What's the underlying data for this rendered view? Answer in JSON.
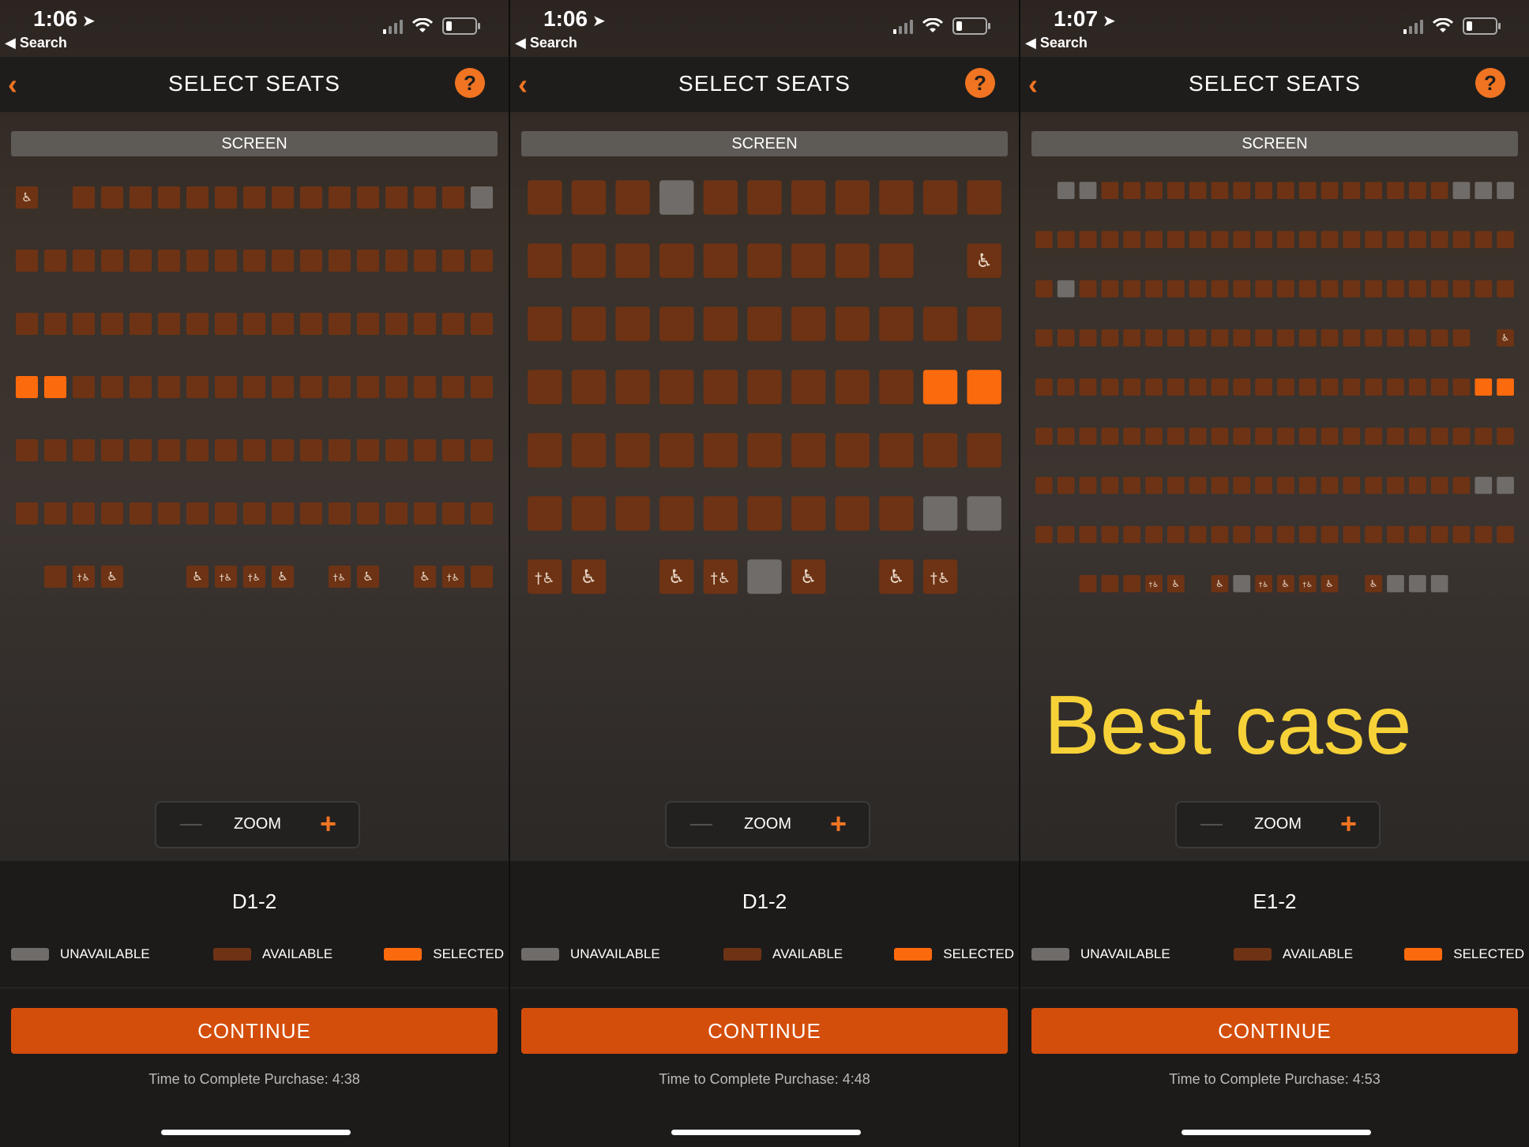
{
  "colors": {
    "unavailable": "#6f6c69",
    "available": "#6e3314",
    "selected": "#fb6a0d",
    "accent": "#f07422",
    "annotation": "#f6d238"
  },
  "icons": {
    "back": "chevron-left-icon",
    "help": "question-mark-icon",
    "wheelchair": "wheelchair-icon",
    "companion": "companion-wheelchair-icon"
  },
  "panels": [
    {
      "status": {
        "time": "1:06",
        "back_label": "Search"
      },
      "nav": {
        "back_glyph": "‹",
        "title": "SELECT SEATS",
        "help_glyph": "?"
      },
      "screen_label": "SCREEN",
      "seat_map": {
        "columns": 17,
        "rows": [
          [
            "W",
            "_",
            "A",
            "A",
            "A",
            "A",
            "A",
            "A",
            "A",
            "A",
            "A",
            "A",
            "A",
            "A",
            "A",
            "A",
            "U"
          ],
          [
            "A",
            "A",
            "A",
            "A",
            "A",
            "A",
            "A",
            "A",
            "A",
            "A",
            "A",
            "A",
            "A",
            "A",
            "A",
            "A",
            "A"
          ],
          [
            "A",
            "A",
            "A",
            "A",
            "A",
            "A",
            "A",
            "A",
            "A",
            "A",
            "A",
            "A",
            "A",
            "A",
            "A",
            "A",
            "A"
          ],
          [
            "S",
            "S",
            "A",
            "A",
            "A",
            "A",
            "A",
            "A",
            "A",
            "A",
            "A",
            "A",
            "A",
            "A",
            "A",
            "A",
            "A"
          ],
          [
            "A",
            "A",
            "A",
            "A",
            "A",
            "A",
            "A",
            "A",
            "A",
            "A",
            "A",
            "A",
            "A",
            "A",
            "A",
            "A",
            "A"
          ],
          [
            "A",
            "A",
            "A",
            "A",
            "A",
            "A",
            "A",
            "A",
            "A",
            "A",
            "A",
            "A",
            "A",
            "A",
            "A",
            "A",
            "A"
          ],
          [
            "_",
            "A",
            "C",
            "W",
            "_",
            "_",
            "W",
            "C",
            "C",
            "W",
            "_",
            "C",
            "W",
            "_",
            "W",
            "C",
            "A"
          ]
        ]
      },
      "zoom": {
        "minus": "—",
        "label": "ZOOM",
        "plus": "+"
      },
      "seat_code": "D1-2",
      "legend": {
        "unavailable": "UNAVAILABLE",
        "available": "AVAILABLE",
        "selected": "SELECTED"
      },
      "continue_label": "CONTINUE",
      "timer": "Time to Complete Purchase: 4:38"
    },
    {
      "status": {
        "time": "1:06",
        "back_label": "Search"
      },
      "nav": {
        "back_glyph": "‹",
        "title": "SELECT SEATS",
        "help_glyph": "?"
      },
      "screen_label": "SCREEN",
      "seat_map": {
        "columns": 11,
        "rows": [
          [
            "A",
            "A",
            "A",
            "U",
            "A",
            "A",
            "A",
            "A",
            "A",
            "A",
            "A"
          ],
          [
            "A",
            "A",
            "A",
            "A",
            "A",
            "A",
            "A",
            "A",
            "A",
            "_",
            "W"
          ],
          [
            "A",
            "A",
            "A",
            "A",
            "A",
            "A",
            "A",
            "A",
            "A",
            "A",
            "A"
          ],
          [
            "A",
            "A",
            "A",
            "A",
            "A",
            "A",
            "A",
            "A",
            "A",
            "S",
            "S"
          ],
          [
            "A",
            "A",
            "A",
            "A",
            "A",
            "A",
            "A",
            "A",
            "A",
            "A",
            "A"
          ],
          [
            "A",
            "A",
            "A",
            "A",
            "A",
            "A",
            "A",
            "A",
            "A",
            "U",
            "U"
          ],
          [
            "C",
            "W",
            "_",
            "W",
            "C",
            "U",
            "W",
            "_",
            "W",
            "C",
            "_"
          ]
        ]
      },
      "zoom": {
        "minus": "—",
        "label": "ZOOM",
        "plus": "+"
      },
      "seat_code": "D1-2",
      "legend": {
        "unavailable": "UNAVAILABLE",
        "available": "AVAILABLE",
        "selected": "SELECTED"
      },
      "continue_label": "CONTINUE",
      "timer": "Time to Complete Purchase: 4:48"
    },
    {
      "status": {
        "time": "1:07",
        "back_label": "Search"
      },
      "nav": {
        "back_glyph": "‹",
        "title": "SELECT SEATS",
        "help_glyph": "?"
      },
      "screen_label": "SCREEN",
      "seat_map": {
        "columns": 22,
        "rows": [
          [
            "_",
            "U",
            "U",
            "A",
            "A",
            "A",
            "A",
            "A",
            "A",
            "A",
            "A",
            "A",
            "A",
            "A",
            "A",
            "A",
            "A",
            "A",
            "A",
            "U",
            "U",
            "U"
          ],
          [
            "A",
            "A",
            "A",
            "A",
            "A",
            "A",
            "A",
            "A",
            "A",
            "A",
            "A",
            "A",
            "A",
            "A",
            "A",
            "A",
            "A",
            "A",
            "A",
            "A",
            "A",
            "A"
          ],
          [
            "A",
            "U",
            "A",
            "A",
            "A",
            "A",
            "A",
            "A",
            "A",
            "A",
            "A",
            "A",
            "A",
            "A",
            "A",
            "A",
            "A",
            "A",
            "A",
            "A",
            "A",
            "A"
          ],
          [
            "A",
            "A",
            "A",
            "A",
            "A",
            "A",
            "A",
            "A",
            "A",
            "A",
            "A",
            "A",
            "A",
            "A",
            "A",
            "A",
            "A",
            "A",
            "A",
            "A",
            "_",
            "W"
          ],
          [
            "A",
            "A",
            "A",
            "A",
            "A",
            "A",
            "A",
            "A",
            "A",
            "A",
            "A",
            "A",
            "A",
            "A",
            "A",
            "A",
            "A",
            "A",
            "A",
            "A",
            "S",
            "S"
          ],
          [
            "A",
            "A",
            "A",
            "A",
            "A",
            "A",
            "A",
            "A",
            "A",
            "A",
            "A",
            "A",
            "A",
            "A",
            "A",
            "A",
            "A",
            "A",
            "A",
            "A",
            "A",
            "A"
          ],
          [
            "A",
            "A",
            "A",
            "A",
            "A",
            "A",
            "A",
            "A",
            "A",
            "A",
            "A",
            "A",
            "A",
            "A",
            "A",
            "A",
            "A",
            "A",
            "A",
            "A",
            "U",
            "U"
          ],
          [
            "A",
            "A",
            "A",
            "A",
            "A",
            "A",
            "A",
            "A",
            "A",
            "A",
            "A",
            "A",
            "A",
            "A",
            "A",
            "A",
            "A",
            "A",
            "A",
            "A",
            "A",
            "A"
          ],
          [
            "_",
            "_",
            "A",
            "A",
            "A",
            "C",
            "W",
            "_",
            "W",
            "U",
            "C",
            "W",
            "C",
            "W",
            "_",
            "W",
            "U",
            "U",
            "U",
            "_",
            "_",
            "_"
          ]
        ]
      },
      "zoom": {
        "minus": "—",
        "label": "ZOOM",
        "plus": "+"
      },
      "seat_code": "E1-2",
      "legend": {
        "unavailable": "UNAVAILABLE",
        "available": "AVAILABLE",
        "selected": "SELECTED"
      },
      "continue_label": "CONTINUE",
      "timer": "Time to Complete Purchase: 4:53",
      "annotation": "Best case"
    }
  ]
}
